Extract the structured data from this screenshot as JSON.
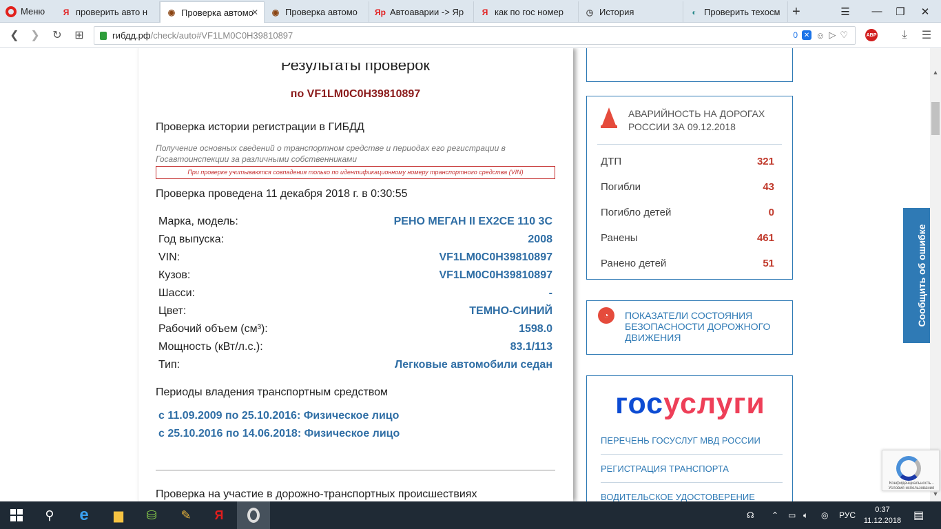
{
  "browser": {
    "menu_label": "Меню",
    "tabs": [
      {
        "label": "проверить авто н",
        "icon": "Я"
      },
      {
        "label": "Проверка автомо",
        "icon": "◉"
      },
      {
        "label": "Проверка автомо",
        "icon": "◉"
      },
      {
        "label": "Автоаварии -> Яр",
        "icon": "Яр"
      },
      {
        "label": "как по гос номер",
        "icon": "Я"
      },
      {
        "label": "История",
        "icon": "◷"
      },
      {
        "label": "Проверить техосм",
        "icon": "◐"
      }
    ],
    "url_host": "гибдд.рф",
    "url_path": "/check/auto#VF1LM0C0H39810897",
    "adblock_count": "0",
    "abp_label": "ABP"
  },
  "report": {
    "title": "Результаты проверок",
    "subtitle": "по VF1LM0C0H39810897",
    "section_registration": "Проверка истории регистрации в ГИБДД",
    "hint": "Получение основных сведений о транспортном средстве и периодах его регистрации в Госавтоинспекции за различными собственниками",
    "warning": "При проверке учитываются совпадения только по идентификационному номеру транспортного средства (VIN)",
    "checked_at": "Проверка проведена 11 декабря 2018 г. в 0:30:55",
    "specs": [
      {
        "k": "Марка, модель:",
        "v": "РЕНО МЕГАН II EX2CE 110 3C"
      },
      {
        "k": "Год выпуска:",
        "v": "2008"
      },
      {
        "k": "VIN:",
        "v": "VF1LM0C0H39810897"
      },
      {
        "k": "Кузов:",
        "v": "VF1LM0C0H39810897"
      },
      {
        "k": "Шасси:",
        "v": "-"
      },
      {
        "k": "Цвет:",
        "v": "ТЕМНО-СИНИЙ"
      },
      {
        "k": "Рабочий объем (см³):",
        "v": "1598.0"
      },
      {
        "k": "Мощность (кВт/л.с.):",
        "v": "83.1/113"
      },
      {
        "k": "Тип:",
        "v": "Легковые автомобили седан"
      }
    ],
    "ownership_title": "Периоды владения транспортным средством",
    "owners": [
      "с 11.09.2009 по 25.10.2016: Физическое лицо",
      "с 25.10.2016 по 14.06.2018: Физическое лицо"
    ],
    "section_accidents": "Проверка на участие в дорожно-транспортных происшествиях"
  },
  "sidebar": {
    "stats_title": "АВАРИЙНОСТЬ НА ДОРОГАХ РОССИИ ЗА 09.12.2018",
    "stats": [
      {
        "k": "ДТП",
        "v": "321"
      },
      {
        "k": "Погибли",
        "v": "43"
      },
      {
        "k": "Погибло детей",
        "v": "0"
      },
      {
        "k": "Ранены",
        "v": "461"
      },
      {
        "k": "Ранено детей",
        "v": "51"
      }
    ],
    "indicators_label": "ПОКАЗАТЕЛИ СОСТОЯНИЯ БЕЗОПАСНОСТИ ДОРОЖНОГО ДВИЖЕНИЯ",
    "gos_logo_a": "гос",
    "gos_logo_b": "услуги",
    "gos_links": [
      "ПЕРЕЧЕНЬ ГОСУСЛУГ МВД РОССИИ",
      "РЕГИСТРАЦИЯ ТРАНСПОРТА",
      "ВОДИТЕЛЬСКОЕ УДОСТОВЕРЕНИЕ"
    ],
    "report_error": "Сообщить об ошибке"
  },
  "recaptcha": {
    "text": "Конфиденциальность - Условия использования"
  },
  "taskbar": {
    "lang": "РУС",
    "time": "0:37",
    "date": "11.12.2018"
  }
}
